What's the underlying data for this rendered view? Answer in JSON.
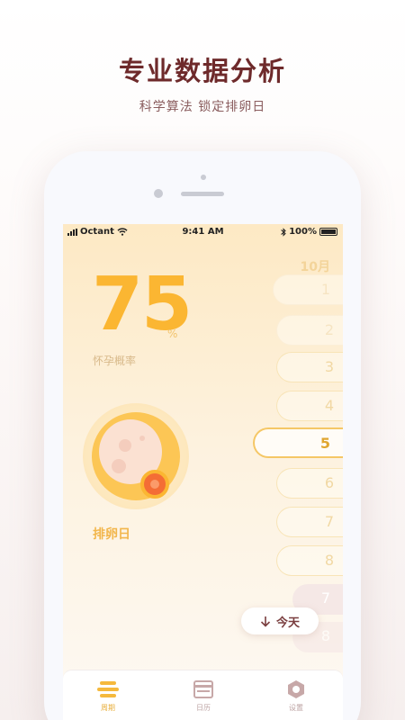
{
  "headline": "专业数据分析",
  "subline": "科学算法 锁定排卵日",
  "status": {
    "carrier": "Octant",
    "time": "9:41 AM",
    "battery": "100%"
  },
  "month": "10月",
  "probability": {
    "value": "75",
    "unit": "%",
    "label": "怀孕概率"
  },
  "ovulation_label": "排卵日",
  "days": [
    "1",
    "2",
    "3",
    "4",
    "5",
    "6",
    "7",
    "8",
    "7",
    "8"
  ],
  "selected_day": "5",
  "today_button": "今天",
  "tabs": [
    {
      "label": "周期",
      "icon": "cycle-icon",
      "active": true
    },
    {
      "label": "日历",
      "icon": "calendar-icon",
      "active": false
    },
    {
      "label": "设置",
      "icon": "settings-icon",
      "active": false
    }
  ],
  "colors": {
    "accent": "#fbb632",
    "brand": "#6e2a2b",
    "orange": "#f46d35"
  }
}
